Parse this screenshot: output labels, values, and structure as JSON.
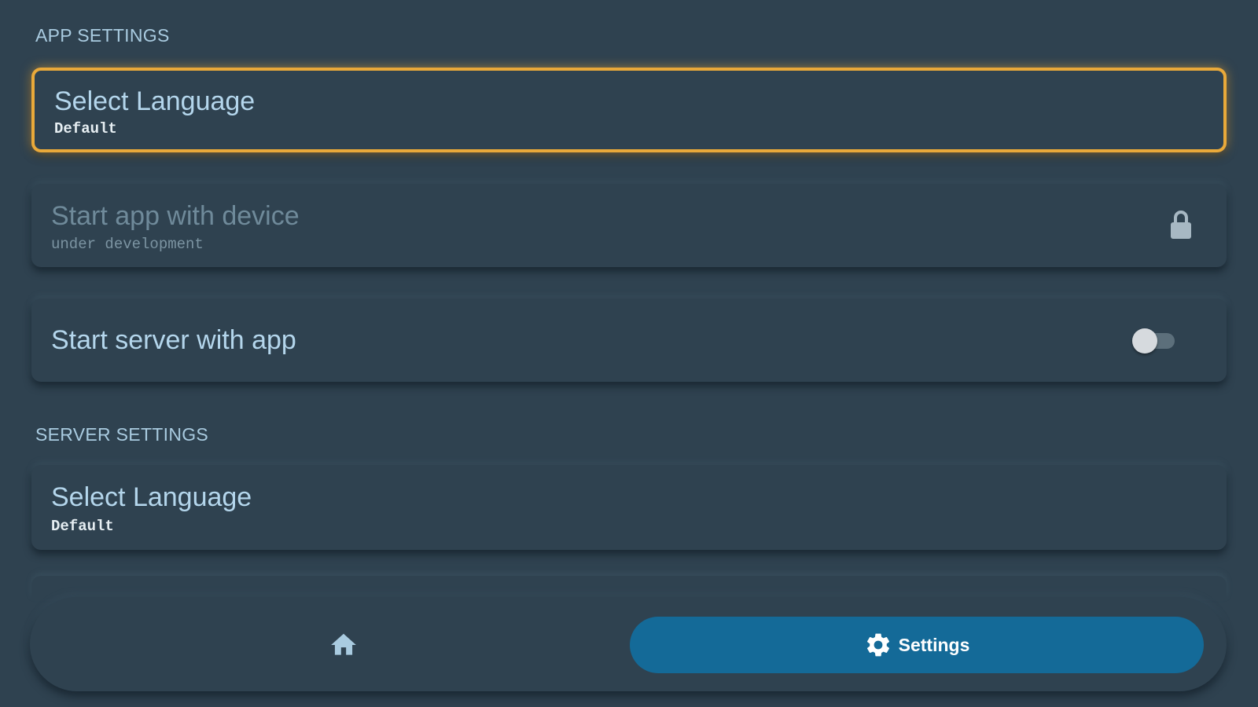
{
  "app_settings": {
    "section_title": "APP SETTINGS",
    "select_language": {
      "title": "Select Language",
      "value": "Default"
    },
    "start_with_device": {
      "title": "Start app with device",
      "subtitle": "under development",
      "locked": true,
      "icon": "lock-icon"
    },
    "start_server": {
      "title": "Start server with app",
      "enabled": false
    }
  },
  "server_settings": {
    "section_title": "SERVER SETTINGS",
    "select_language": {
      "title": "Select Language",
      "value": "Default"
    }
  },
  "nav": {
    "home_icon": "home-icon",
    "settings_icon": "gear-icon",
    "settings_label": "Settings",
    "active_tab": "settings"
  },
  "colors": {
    "background": "#2f4250",
    "accent_focus": "#e9a93a",
    "active_tab": "#146a98",
    "title_text": "#b4d6ec"
  }
}
